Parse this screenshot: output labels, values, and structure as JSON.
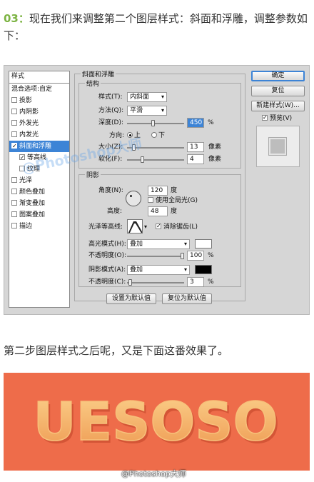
{
  "intro": {
    "step": "03：",
    "text": "现在我们来调整第二个图层样式：斜面和浮雕，调整参数如下："
  },
  "dialog": {
    "sidebar": {
      "title": "样式",
      "items": [
        {
          "label": "混合选项:自定",
          "checkbox": false
        },
        {
          "label": "投影",
          "checkbox": true,
          "checked": false
        },
        {
          "label": "内阴影",
          "checkbox": true,
          "checked": false
        },
        {
          "label": "外发光",
          "checkbox": true,
          "checked": false
        },
        {
          "label": "内发光",
          "checkbox": true,
          "checked": false
        },
        {
          "label": "斜面和浮雕",
          "checkbox": true,
          "checked": true,
          "active": true
        },
        {
          "label": "等高线",
          "checkbox": true,
          "checked": true,
          "sub": true
        },
        {
          "label": "纹理",
          "checkbox": true,
          "checked": false,
          "sub": true
        },
        {
          "label": "光泽",
          "checkbox": true,
          "checked": false
        },
        {
          "label": "颜色叠加",
          "checkbox": true,
          "checked": false
        },
        {
          "label": "渐变叠加",
          "checkbox": true,
          "checked": false
        },
        {
          "label": "图案叠加",
          "checkbox": true,
          "checked": false
        },
        {
          "label": "描边",
          "checkbox": true,
          "checked": false
        }
      ]
    },
    "bevel": {
      "legend": "斜面和浮雕",
      "structure_legend": "结构",
      "style_label": "样式(T):",
      "style_value": "内斜面",
      "technique_label": "方法(Q):",
      "technique_value": "平滑",
      "depth_label": "深度(D):",
      "depth_value": "450",
      "depth_unit": "%",
      "depth_level": 0.45,
      "direction_label": "方向:",
      "direction_up": "上",
      "direction_down": "下",
      "size_label": "大小(Z):",
      "size_value": "13",
      "size_unit": "像素",
      "size_level": 0.09,
      "soften_label": "软化(F):",
      "soften_value": "4",
      "soften_unit": "像素",
      "soften_level": 0.25
    },
    "shading": {
      "legend": "阴影",
      "angle_label": "角度(N):",
      "angle_value": "120",
      "angle_unit": "度",
      "global_light_label": "使用全局光(G)",
      "altitude_label": "高度:",
      "altitude_value": "48",
      "altitude_unit": "度",
      "gloss_label": "光泽等高线:",
      "antialias_label": "消除锯齿(L)",
      "highlight_label": "高光模式(H):",
      "highlight_value": "叠加",
      "highlight_color": "#ffffff",
      "highlight_opacity_label": "不透明度(O):",
      "highlight_opacity_value": "100",
      "highlight_opacity_level": 1.0,
      "shadow_label": "阴影模式(A):",
      "shadow_value": "叠加",
      "shadow_color": "#000000",
      "shadow_opacity_label": "不透明度(C):",
      "shadow_opacity_value": "3",
      "shadow_opacity_level": 0.03,
      "percent": "%"
    },
    "buttons": {
      "ok": "确定",
      "reset": "复位",
      "new_style": "新建样式(W)...",
      "preview": "预览(V)",
      "make_default": "设置为默认值",
      "reset_default": "复位为默认值"
    },
    "watermark": "@Photoshop大师"
  },
  "paragraph": "第二步图层样式之后呢，又是下面这番效果了。",
  "banner": {
    "text": "UESOSO",
    "bg_color": "#ee6c4a",
    "text_color": "#f5b56b",
    "credit": "@Photoshop大师"
  }
}
